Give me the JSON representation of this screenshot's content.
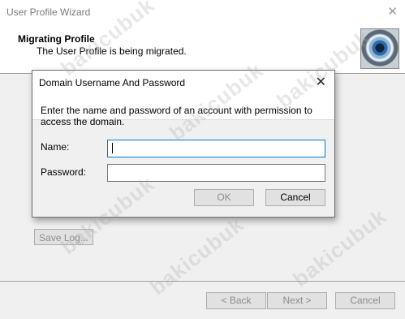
{
  "window": {
    "title": "User Profile Wizard",
    "close_glyph": "✕"
  },
  "header": {
    "title": "Migrating Profile",
    "subtitle": "The User Profile is being migrated.",
    "image_icon": "eye-image"
  },
  "main": {
    "save_log_label": "Save Log..."
  },
  "nav": {
    "back_label": "< Back",
    "next_label": "Next >",
    "cancel_label": "Cancel"
  },
  "dialog": {
    "title": "Domain Username And Password",
    "close_glyph": "✕",
    "message": "Enter the name and password of an account with permission to access the domain.",
    "name_label": "Name:",
    "name_value": "",
    "password_label": "Password:",
    "password_value": "",
    "ok_label": "OK",
    "cancel_label": "Cancel"
  },
  "watermark": {
    "text": "bakicubuk"
  }
}
